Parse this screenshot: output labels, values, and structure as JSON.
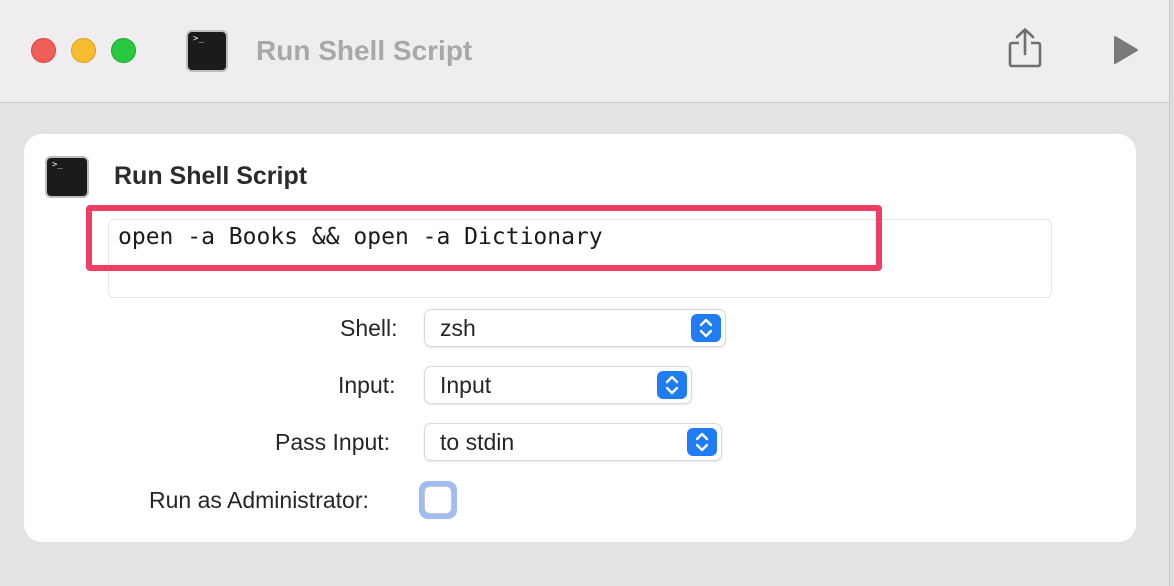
{
  "window": {
    "title": "Run Shell Script"
  },
  "toolbar": {
    "share_icon": "share-icon",
    "play_icon": "play-icon"
  },
  "action": {
    "title": "Run Shell Script",
    "icon": "terminal-icon",
    "prompt_glyph": ">_",
    "script": "open -a Books && open -a Dictionary"
  },
  "options": {
    "shell": {
      "label": "Shell:",
      "value": "zsh"
    },
    "input": {
      "label": "Input:",
      "value": "Input"
    },
    "pass_input": {
      "label": "Pass Input:",
      "value": "to stdin"
    },
    "run_as_admin": {
      "label": "Run as Administrator:",
      "checked": false
    }
  },
  "colors": {
    "accent": "#1f7cf5",
    "highlight": "#ef3d63",
    "close": "#ed5f57",
    "minimize": "#f5bd2f",
    "zoom": "#28c840"
  }
}
